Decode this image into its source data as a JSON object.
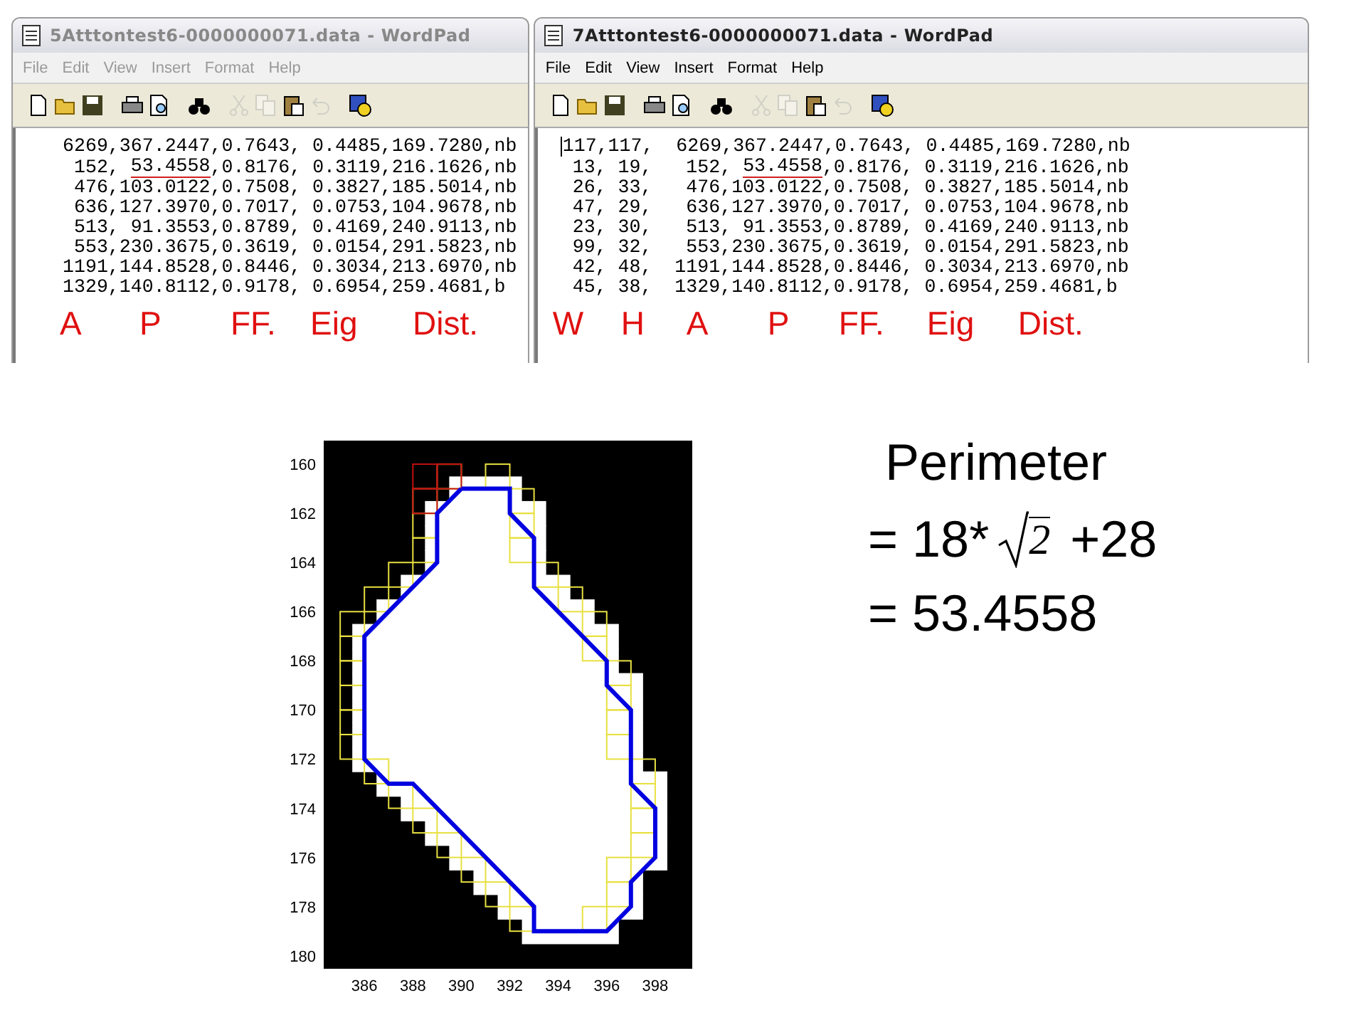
{
  "windows": [
    {
      "title": "5Atttontest6-0000000071.data - WordPad",
      "active": false,
      "menu": [
        "File",
        "Edit",
        "View",
        "Insert",
        "Format",
        "Help"
      ],
      "toolbar": [
        {
          "kind": "new",
          "disabled": false
        },
        {
          "kind": "open",
          "disabled": false
        },
        {
          "kind": "save",
          "disabled": false
        },
        {
          "kind": "print",
          "disabled": false
        },
        {
          "kind": "preview",
          "disabled": false
        },
        {
          "kind": "find",
          "disabled": false
        },
        {
          "kind": "cut",
          "disabled": true
        },
        {
          "kind": "copy",
          "disabled": true
        },
        {
          "kind": "paste",
          "disabled": false
        },
        {
          "kind": "undo",
          "disabled": true
        },
        {
          "kind": "datetime",
          "disabled": false
        }
      ],
      "cursor": false,
      "lines": [
        [
          {
            "text": "6269,367.2447,0.7643, 0.4485,169.7280,nb",
            "underlined": false
          }
        ],
        [
          {
            "text": " 152, ",
            "underlined": false
          },
          {
            "text": "53.4558",
            "underlined": true
          },
          {
            "text": ",0.8176, 0.3119,216.1626,nb",
            "underlined": false
          }
        ],
        [
          {
            "text": " 476,103.0122,0.7508, 0.3827,185.5014,nb",
            "underlined": false
          }
        ],
        [
          {
            "text": " 636,127.3970,0.7017, 0.0753,104.9678,nb",
            "underlined": false
          }
        ],
        [
          {
            "text": " 513, 91.3553,0.8789, 0.4169,240.9113,nb",
            "underlined": false
          }
        ],
        [
          {
            "text": " 553,230.3675,0.3619, 0.0154,291.5823,nb",
            "underlined": false
          }
        ],
        [
          {
            "text": "1191,144.8528,0.8446, 0.3034,213.6970,nb",
            "underlined": false
          }
        ],
        [
          {
            "text": "1329,140.8112,0.9178, 0.6954,259.4681,b",
            "underlined": false
          }
        ]
      ],
      "column_labels": [
        "A",
        "P",
        "FF.",
        "Eig",
        "Dist."
      ]
    },
    {
      "title": "7Atttontest6-0000000071.data - WordPad",
      "active": true,
      "menu": [
        "File",
        "Edit",
        "View",
        "Insert",
        "Format",
        "Help"
      ],
      "toolbar": [
        {
          "kind": "new",
          "disabled": false
        },
        {
          "kind": "open",
          "disabled": false
        },
        {
          "kind": "save",
          "disabled": false
        },
        {
          "kind": "print",
          "disabled": false
        },
        {
          "kind": "preview",
          "disabled": false
        },
        {
          "kind": "find",
          "disabled": false
        },
        {
          "kind": "cut",
          "disabled": true
        },
        {
          "kind": "copy",
          "disabled": true
        },
        {
          "kind": "paste",
          "disabled": false
        },
        {
          "kind": "undo",
          "disabled": true
        },
        {
          "kind": "datetime",
          "disabled": false
        }
      ],
      "cursor": true,
      "lines": [
        [
          {
            "text": "117,117,  6269,367.2447,0.7643, 0.4485,169.7280,nb",
            "underlined": false
          }
        ],
        [
          {
            "text": " 13, 19,   152, ",
            "underlined": false
          },
          {
            "text": "53.4558",
            "underlined": true
          },
          {
            "text": ",0.8176, 0.3119,216.1626,nb",
            "underlined": false
          }
        ],
        [
          {
            "text": " 26, 33,   476,103.0122,0.7508, 0.3827,185.5014,nb",
            "underlined": false
          }
        ],
        [
          {
            "text": " 47, 29,   636,127.3970,0.7017, 0.0753,104.9678,nb",
            "underlined": false
          }
        ],
        [
          {
            "text": " 23, 30,   513, 91.3553,0.8789, 0.4169,240.9113,nb",
            "underlined": false
          }
        ],
        [
          {
            "text": " 99, 32,   553,230.3675,0.3619, 0.0154,291.5823,nb",
            "underlined": false
          }
        ],
        [
          {
            "text": " 42, 48,  1191,144.8528,0.8446, 0.3034,213.6970,nb",
            "underlined": false
          }
        ],
        [
          {
            "text": " 45, 38,  1329,140.8112,0.9178, 0.6954,259.4681,b",
            "underlined": false
          }
        ]
      ],
      "column_labels": [
        "W",
        "H",
        "A",
        "P",
        "FF.",
        "Eig",
        "Dist."
      ]
    }
  ],
  "plot": {
    "x_tick_labels": [
      "386",
      "388",
      "390",
      "392",
      "394",
      "396",
      "398"
    ],
    "y_tick_labels": [
      "160",
      "162",
      "164",
      "166",
      "168",
      "170",
      "172",
      "174",
      "176",
      "178",
      "180"
    ]
  },
  "note": {
    "title": "Perimeter",
    "line1": {
      "prefix": "= 18*",
      "radicand": "2",
      "suffix": "+28"
    },
    "line2": "= 53.4558"
  }
}
